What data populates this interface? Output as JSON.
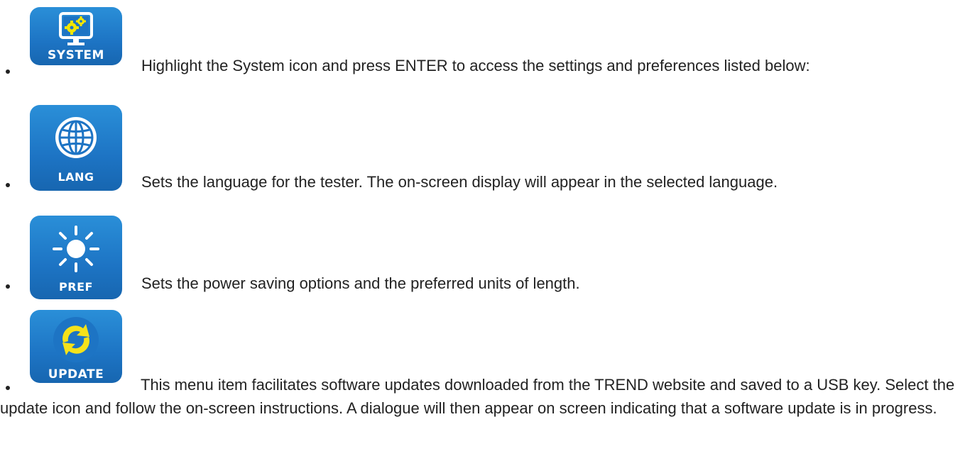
{
  "items": [
    {
      "icon_label": "SYSTEM",
      "icon": "system-monitor-gears-icon",
      "text": "Highlight the System icon and press ENTER to access the settings and preferences listed below:"
    },
    {
      "icon_label": "LANG",
      "icon": "globe-icon",
      "text": "Sets the language for the tester. The on-screen display will appear in the selected language."
    },
    {
      "icon_label": "PREF",
      "icon": "sun-icon",
      "text": "Sets the power saving options and the preferred units of length."
    },
    {
      "icon_label": "UPDATE",
      "icon": "refresh-arrows-icon",
      "text": "This menu item facilitates software updates downloaded from the TREND website and saved to a USB key. Select the update icon and follow the on-screen instructions. A dialogue will then appear on screen indicating that a software update is in progress."
    }
  ],
  "colors": {
    "icon_blue": "#1d74c4",
    "gear_yellow": "#f3e600",
    "arrow_yellow": "#f5e21a",
    "text": "#222222"
  }
}
